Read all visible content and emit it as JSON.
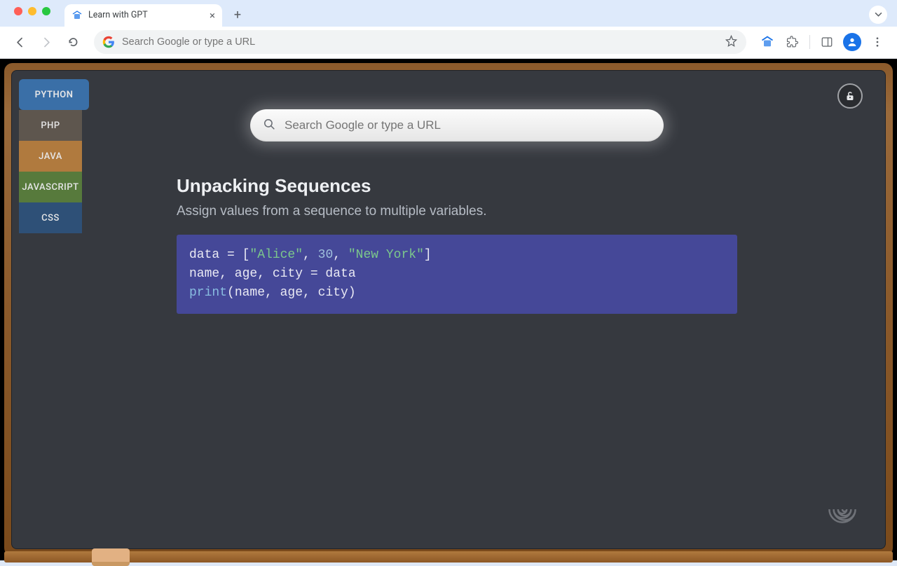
{
  "browser": {
    "tab_title": "Learn with GPT",
    "omnibox_placeholder": "Search Google or type a URL"
  },
  "sidebar": {
    "items": [
      {
        "label": "PYTHON",
        "active": true
      },
      {
        "label": "PHP"
      },
      {
        "label": "JAVA"
      },
      {
        "label": "JAVASCRIPT"
      },
      {
        "label": "CSS"
      }
    ]
  },
  "search": {
    "placeholder": "Search Google or type a URL"
  },
  "lesson": {
    "title": "Unpacking Sequences",
    "subtitle": "Assign values from a sequence to multiple variables.",
    "code": {
      "line1_a": "data = [",
      "line1_str1": "\"Alice\"",
      "line1_b": ", ",
      "line1_num": "30",
      "line1_c": ", ",
      "line1_str2": "\"New York\"",
      "line1_d": "]",
      "line2": "name, age, city = data",
      "line3_fn": "print",
      "line3_rest": "(name, age, city)"
    }
  }
}
